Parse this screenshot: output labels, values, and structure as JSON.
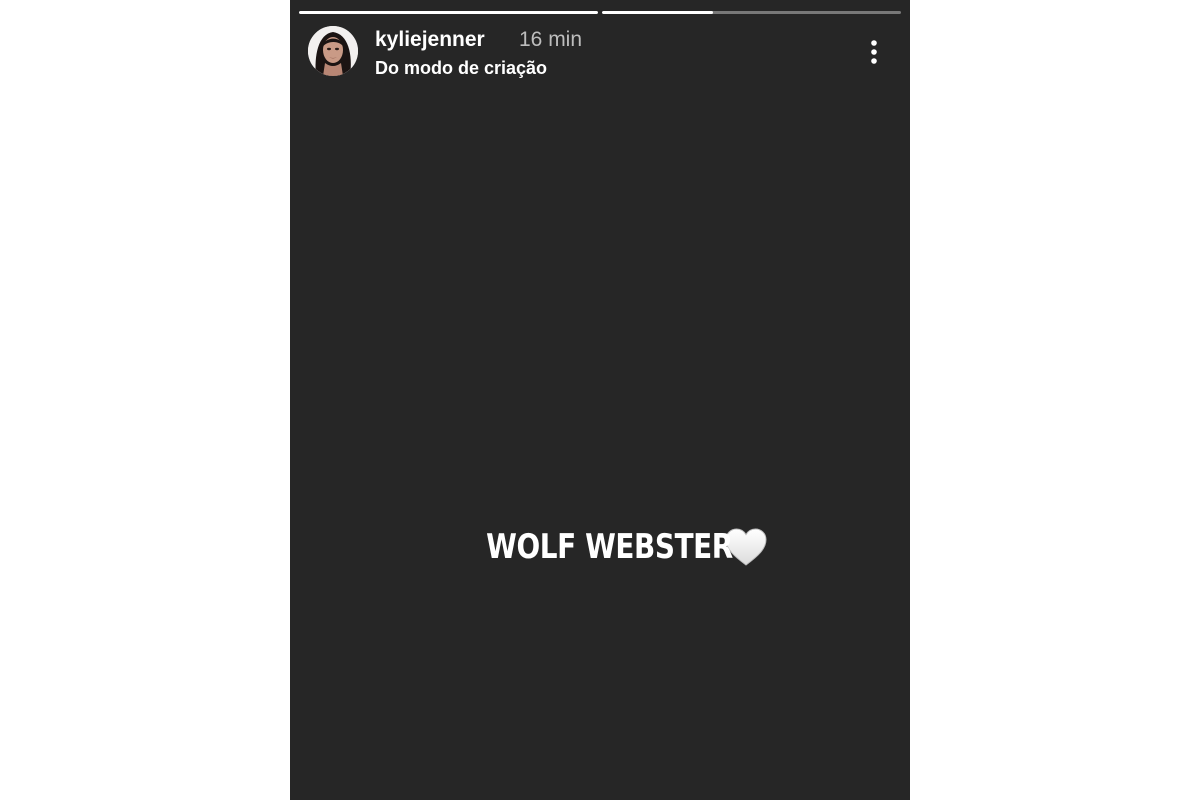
{
  "story": {
    "progress": [
      {
        "fill": 1.0
      },
      {
        "fill": 0.37
      }
    ],
    "header": {
      "username": "kyliejenner",
      "time": "16 min",
      "subtitle": "Do modo de criação",
      "avatar_icon": "profile-photo",
      "more_icon": "more-vertical-icon"
    },
    "caption": {
      "text": "WOLF WEBSTER",
      "emoji_icon": "white-heart-icon"
    },
    "colors": {
      "background": "#262626",
      "text": "#ffffff",
      "muted": "#bdbdbd"
    }
  }
}
